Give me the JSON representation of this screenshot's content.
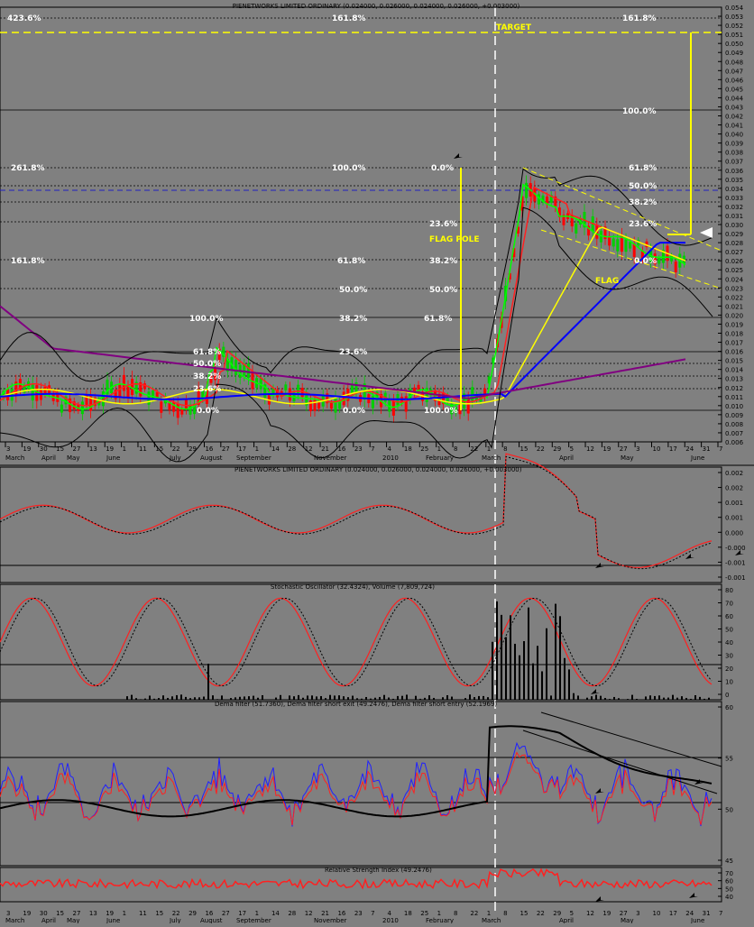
{
  "chart_data": [
    {
      "type": "line",
      "title": "PIENETWORKS LIMITED ORDINARY (0.024000, 0.026000, 0.024000, 0.026000, +0.003000)",
      "y_ticks": [
        "0.054",
        "0.053",
        "0.052",
        "0.051",
        "0.050",
        "0.049",
        "0.048",
        "0.047",
        "0.046",
        "0.045",
        "0.044",
        "0.043",
        "0.042",
        "0.041",
        "0.040",
        "0.039",
        "0.038",
        "0.037",
        "0.036",
        "0.035",
        "0.034",
        "0.033",
        "0.032",
        "0.031",
        "0.030",
        "0.029",
        "0.028",
        "0.027",
        "0.026",
        "0.025",
        "0.024",
        "0.023",
        "0.022",
        "0.021",
        "0.020",
        "0.019",
        "0.018",
        "0.017",
        "0.016",
        "0.015",
        "0.014",
        "0.013",
        "0.012",
        "0.011",
        "0.010",
        "0.009",
        "0.008",
        "0.007",
        "0.006"
      ],
      "ylim": [
        0.006,
        0.054
      ],
      "x_ticks": [
        "3",
        "19",
        "30",
        "15",
        "27",
        "13",
        "19",
        "1",
        "11",
        "15",
        "22",
        "29",
        "16",
        "27",
        "17",
        "1",
        "14",
        "28",
        "12",
        "21",
        "16",
        "23",
        "7",
        "4",
        "18",
        "25",
        "1",
        "8",
        "22",
        "1",
        "8",
        "15",
        "22",
        "29",
        "5",
        "12",
        "19",
        "27",
        "3",
        "10",
        "17",
        "24",
        "31",
        "7"
      ],
      "months": [
        "March",
        "April",
        "May",
        "June",
        "July",
        "August",
        "September",
        "November",
        "2010",
        "February",
        "March",
        "April",
        "May",
        "June"
      ],
      "annotations": [
        "423.6%",
        "161.8%",
        "161.8%",
        "TARGET",
        "100.0%",
        "261.8%",
        "100.0%",
        "0.0%",
        "61.8%",
        "50.0%",
        "38.2%",
        "23.6%",
        "23.6%",
        "FLAG POLE",
        "161.8%",
        "61.8%",
        "38.2%",
        "0.0%",
        "FLAG",
        "50.0%",
        "50.0%",
        "100.0%",
        "38.2%",
        "61.8%",
        "61.8%",
        "50.0%",
        "38.2%",
        "23.6%",
        "23.6%",
        "0.0%",
        "0.0%",
        "100.0%"
      ]
    },
    {
      "type": "line",
      "title": "PIENETWORKS LIMITED ORDINARY (0.024000, 0.026000, 0.024000, 0.026000, +0.003000)",
      "y_ticks": [
        "0.002",
        "0.002",
        "0.001",
        "0.001",
        "0.000",
        "-0.000",
        "-0.001",
        "-0.001"
      ]
    },
    {
      "type": "line",
      "title": "Stochastic Oscillator (32.4324), Volume (7,809,724)",
      "y_ticks": [
        "80",
        "70",
        "60",
        "50",
        "40",
        "30",
        "20",
        "10",
        "0"
      ],
      "ylim": [
        0,
        80
      ]
    },
    {
      "type": "line",
      "title": "Dema filter (51.7360), Dema filter short exit (49.2476), Dema filter short entry (52.1969)",
      "y_ticks": [
        "60",
        "55",
        "50",
        "45"
      ],
      "ylim": [
        44,
        63
      ]
    },
    {
      "type": "line",
      "title": "Relative Strength Index (49.2476)",
      "y_ticks": [
        "70",
        "60",
        "50",
        "40"
      ],
      "ylim": [
        38,
        75
      ]
    }
  ],
  "colors": {
    "background": "#808080",
    "price_up": "#00d000",
    "price_down": "#ff0000",
    "ma_yellow": "#ffff00",
    "ma_blue": "#0000ff",
    "ma_purple": "#800080",
    "target": "#ffff00"
  }
}
